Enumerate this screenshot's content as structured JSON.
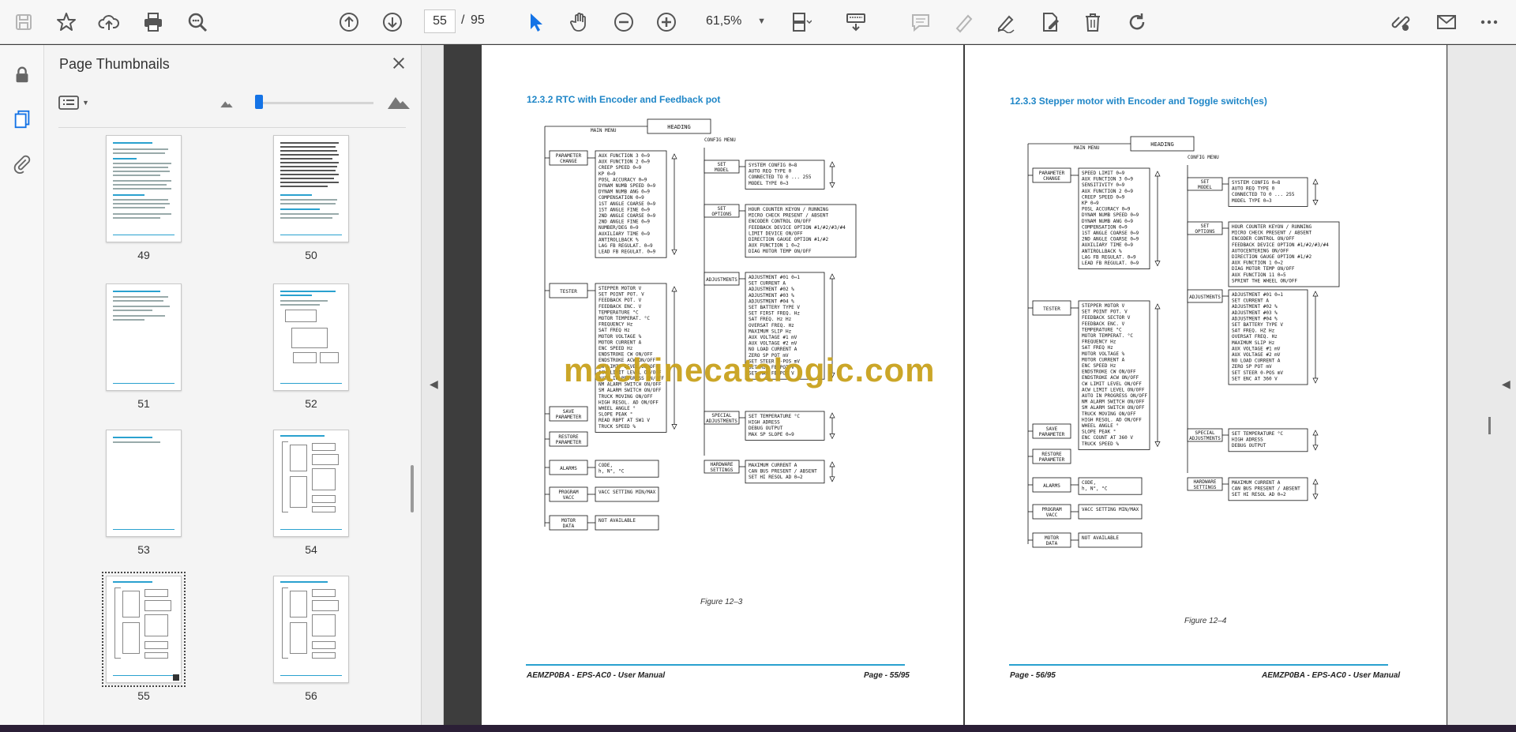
{
  "toolbar": {
    "page_current": "55",
    "page_separator": "/",
    "page_total": "95",
    "zoom": "61,5%"
  },
  "panel": {
    "title": "Page Thumbnails"
  },
  "thumbnails": [
    {
      "label": "49"
    },
    {
      "label": "50"
    },
    {
      "label": "51"
    },
    {
      "label": "52"
    },
    {
      "label": "53"
    },
    {
      "label": "54"
    },
    {
      "label": "55"
    },
    {
      "label": "56"
    }
  ],
  "page_left": {
    "section": "12.3.2 RTC with Encoder and Feedback pot",
    "figure": "Figure 12–3",
    "footer_left": "AEMZP0BA - EPS-AC0 - User Manual",
    "footer_right": "Page - 55/95",
    "diagram": {
      "heading": "HEADING",
      "main_menu": "MAIN MENU",
      "config_menu": "CONFIG MENU",
      "blocks": [
        {
          "label": "PARAMETER CHANGE",
          "items": [
            "AUX FUNCTION 3   0⇔9",
            "AUX FUNCTION 2   0⇔9",
            "CREEP SPEED      0⇔9",
            "KP               0⇔9",
            "POSL ACCURACY    0⇔9",
            "DYNAM NUMB SPEED 0⇔9",
            "DYNAM NUMB ANG   0⇔9",
            "COMPENSATION     0⇔9",
            "1ST ANGLE COARSE 0⇔9",
            "1ST ANGLE FINE   0⇔9",
            "2ND ANGLE COARSE 0⇔9",
            "2ND ANGLE FINE   0⇔9",
            "NUMBER/DEG       0⇔9",
            "AUXILIARY TIME   0⇔9",
            "ANTIROLLBACK     %",
            "LAG FB REGULAT.  0⇔9",
            "LEAD FB REGULAT. 0⇔9"
          ]
        },
        {
          "label": "TESTER",
          "items": [
            "STEPPER MOTOR   V",
            "SET POINT POT.  V",
            "FEEDBACK POT.   V",
            "FEEDBACK ENC.   V",
            "TEMPERATURE     °C",
            "MOTOR TEMPERAT. °C",
            "FREQUENCY       Hz",
            "SAT FREQ        Hz",
            "MOTOR VOLTAGE   %",
            "MOTOR CURRENT   A",
            "ENC SPEED       Hz",
            "ENDSTROKE CW    ON/OFF",
            "ENDSTROKE ACW   ON/OFF",
            "CW LIMIT LEVEL  ON/OFF",
            "ACW LIMIT LEVEL ON/OFF",
            "AUTO IN PROGRESS ON/OFF",
            "NM ALARM SWITCH ON/OFF",
            "SM ALARM SWITCH ON/OFF",
            "TRUCK MOVING    ON/OFF",
            "HIGH RESOL. AD  ON/OFF",
            "WHEEL ANGLE     °",
            "SLOPE PEAK      °",
            "READ RBPT AT SW1 V",
            "TRUCK SPEED     %"
          ]
        },
        {
          "label": "SAVE PARAMETER",
          "items": []
        },
        {
          "label": "RESTORE PARAMETER",
          "items": []
        },
        {
          "label": "ALARMS",
          "items": [
            "CODE,",
            "h, N°, °C"
          ]
        },
        {
          "label": "PROGRAM VACC",
          "items": [
            "VACC SETTING   MIN/MAX"
          ]
        },
        {
          "label": "MOTOR DATA",
          "items": [
            "NOT AVAILABLE"
          ]
        }
      ],
      "config_blocks": [
        {
          "label": "SET MODEL",
          "items": [
            "SYSTEM CONFIG    0⇔8",
            "AUTO REQ TYPE    0",
            "CONNECTED TO     0 ... 255",
            "MODEL TYPE       0⇔3"
          ]
        },
        {
          "label": "SET OPTIONS",
          "items": [
            "HOUR COUNTER  KEYON / RUNNING",
            "MICRO CHECK   PRESENT / ABSENT",
            "ENCODER CONTROL ON/OFF",
            "FEEDBACK DEVICE OPTION #1/#2/#3/#4",
            "LIMIT DEVICE  ON/OFF",
            "DIRECTION GAUGE OPTION #1/#2",
            "AUX FUNCTION 1 0⇔2",
            "DIAG MOTOR TEMP ON/OFF"
          ]
        },
        {
          "label": "ADJUSTMENTS",
          "items": [
            "ADJUSTMENT #01  0⇔1",
            "SET CURRENT     A",
            "ADJUSTMENT #02  %",
            "ADJUSTMENT #03  %",
            "ADJUSTMENT #04  %",
            "SET BATTERY TYPE V",
            "SET FIRST FREQ. Hz",
            "SAT FREQ. Hz    Hz",
            "OVERSAT FREQ.   Hz",
            "MAXIMUM SLIP    Hz",
            "AUX VOLTAGE #1  mV",
            "AUX VOLTAGE #2  mV",
            "NO LOAD CURRENT A",
            "ZERO SP POT     mV",
            "SET STEER 0-POS mV",
            "SET MIN FB POT  V",
            "SET MAX FB POT  V"
          ]
        },
        {
          "label": "SPECIAL ADJUSTMENTS",
          "items": [
            "SET TEMPERATURE  °C",
            "HIGH ADRESS",
            "DEBUG OUTPUT",
            "MAX SP SLOPE     0⇔9"
          ]
        },
        {
          "label": "HARDWARE SETTINGS",
          "items": [
            "MAXIMUM CURRENT  A",
            "CAN BUS   PRESENT / ABSENT",
            "SET HI RESOL AD  0⇔2"
          ]
        }
      ]
    }
  },
  "page_right": {
    "section": "12.3.3 Stepper motor with Encoder and Toggle switch(es)",
    "figure": "Figure 12–4",
    "footer_left": "Page - 56/95",
    "footer_right": "AEMZP0BA - EPS-AC0 - User Manual",
    "diagram": {
      "heading": "HEADING",
      "main_menu": "MAIN MENU",
      "config_menu": "CONFIG MENU",
      "blocks": [
        {
          "label": "PARAMETER CHANGE",
          "items": [
            "SPEED LIMIT      0⇔9",
            "AUX FUNCTION 3   0⇔9",
            "SENSITIVITY      0⇔9",
            "AUX FUNCTION 2   0⇔9",
            "CREEP SPEED      0⇔9",
            "KP               0⇔9",
            "POSL ACCURACY    0⇔9",
            "DYNAM NUMB SPEED 0⇔9",
            "DYNAM NUMB ANG   0⇔9",
            "COMPENSATION     0⇔9",
            "1ST ANGLE COARSE 0⇔9",
            "2ND ANGLE COARSE 0⇔9",
            "AUXILIARY TIME   0⇔9",
            "ANTIROLLBACK     %",
            "LAG FB REGULAT.  0⇔9",
            "LEAD FB REGULAT. 0⇔9"
          ]
        },
        {
          "label": "TESTER",
          "items": [
            "STEPPER MOTOR   V",
            "SET POINT POT.  V",
            "FEEDBACK SECTOR V",
            "FEEDBACK ENC.   V",
            "TEMPERATURE     °C",
            "MOTOR TEMPERAT. °C",
            "FREQUENCY       Hz",
            "SAT FREQ        Hz",
            "MOTOR VOLTAGE   %",
            "MOTOR CURRENT   A",
            "ENC SPEED       Hz",
            "ENDSTROKE CW    ON/OFF",
            "ENDSTROKE ACW   ON/OFF",
            "CW LIMIT LEVEL  ON/OFF",
            "ACW LIMIT LEVEL ON/OFF",
            "AUTO IN PROGRESS ON/OFF",
            "NM ALARM SWITCH ON/OFF",
            "SM ALARM SWITCH ON/OFF",
            "TRUCK MOVING    ON/OFF",
            "HIGH RESOL. AD  ON/OFF",
            "WHEEL ANGLE     °",
            "SLOPE PEAK      °",
            "ENC COUNT AT 360 V",
            "TRUCK SPEED     %"
          ]
        },
        {
          "label": "SAVE PARAMETER",
          "items": []
        },
        {
          "label": "RESTORE PARAMETER",
          "items": []
        },
        {
          "label": "ALARMS",
          "items": [
            "CODE,",
            "h, N°, °C"
          ]
        },
        {
          "label": "PROGRAM VACC",
          "items": [
            "VACC SETTING   MIN/MAX"
          ]
        },
        {
          "label": "MOTOR DATA",
          "items": [
            "NOT AVAILABLE"
          ]
        }
      ],
      "config_blocks": [
        {
          "label": "SET MODEL",
          "items": [
            "SYSTEM CONFIG    0⇔8",
            "AUTO REQ TYPE    0",
            "CONNECTED TO     0 ... 255",
            "MODEL TYPE       0⇔3"
          ]
        },
        {
          "label": "SET OPTIONS",
          "items": [
            "HOUR COUNTER  KEYON / RUNNING",
            "MICRO CHECK   PRESENT / ABSENT",
            "ENCODER CONTROL ON/OFF",
            "FEEDBACK DEVICE OPTION #1/#2/#3/#4",
            "AUTOCENTERING ON/OFF",
            "DIRECTION GAUGE OPTION #1/#2",
            "AUX FUNCTION 1 0⇔2",
            "DIAG MOTOR TEMP ON/OFF",
            "AUX FUNCTION 11 0⇔5",
            "SPRINT THE WHEEL ON/OFF"
          ]
        },
        {
          "label": "ADJUSTMENTS",
          "items": [
            "ADJUSTMENT #01  0⇔1",
            "SET CURRENT     A",
            "ADJUSTMENT #02  %",
            "ADJUSTMENT #03  %",
            "ADJUSTMENT #04  %",
            "SET BATTERY TYPE V",
            "SAT FREQ. HZ    Hz",
            "OVERSAT FREQ.   Hz",
            "MAXIMUM SLIP    Hz",
            "AUX VOLTAGE #1  mV",
            "AUX VOLTAGE #2  mV",
            "NO LOAD CURRENT A",
            "ZERO SP POT     mV",
            "SET STEER 0-POS mV",
            "SET ENC AT 360  V"
          ]
        },
        {
          "label": "SPECIAL ADJUSTMENTS",
          "items": [
            "SET TEMPERATURE  °C",
            "HIGH ADRESS",
            "DEBUG OUTPUT"
          ]
        },
        {
          "label": "HARDWARE SETTINGS",
          "items": [
            "MAXIMUM CURRENT  A",
            "CAN BUS   PRESENT / ABSENT",
            "SET HI RESOL AD  0⇔2"
          ]
        }
      ]
    }
  },
  "watermark": "machinecatalogic.com",
  "colors": {
    "accent": "#1473e6",
    "section_heading": "#1f86c7",
    "watermark": "#c9a21d"
  }
}
